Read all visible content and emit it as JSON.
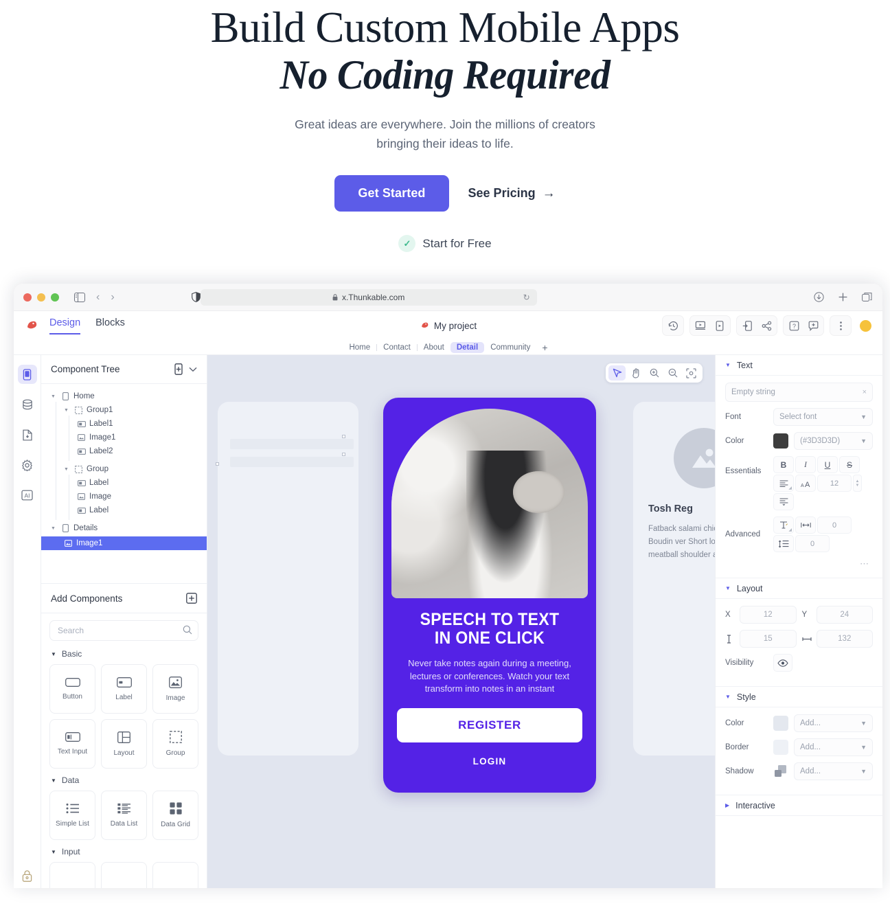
{
  "hero": {
    "headline_line1": "Build Custom Mobile Apps",
    "headline_line2": "No Coding Required",
    "subtext": "Great ideas are everywhere. Join the millions of creators bringing their ideas to life.",
    "primary_cta": "Get Started",
    "secondary_cta": "See Pricing",
    "secondary_cta_icon": "arrow-right-icon",
    "free_label": "Start for Free",
    "free_icon": "check-icon",
    "accent_color": "#5c5ce8",
    "check_color": "#3fba8e"
  },
  "browser": {
    "url": "x.Thunkable.com",
    "lock_icon": "lock-icon",
    "reload_icon": "reload-icon",
    "sidebar_icon": "sidebar-toggle-icon",
    "back_icon": "chevron-left-icon",
    "forward_icon": "chevron-right-icon",
    "shield_icon": "privacy-shield-icon",
    "download_icon": "download-icon",
    "newtab_icon": "plus-icon",
    "tabs_icon": "tab-overview-icon",
    "traffic_lights": [
      "close",
      "minimize",
      "zoom"
    ]
  },
  "app": {
    "logo_icon": "thunkable-logo-icon",
    "tabs": [
      {
        "label": "Design",
        "active": true
      },
      {
        "label": "Blocks",
        "active": false
      }
    ],
    "project_name": "My project",
    "toolbar_groups": [
      {
        "icons": [
          {
            "name": "version-history-icon"
          }
        ]
      },
      {
        "icons": [
          {
            "name": "preview-web-icon"
          },
          {
            "name": "preview-mobile-icon"
          }
        ]
      },
      {
        "icons": [
          {
            "name": "install-app-icon"
          },
          {
            "name": "share-icon"
          }
        ]
      },
      {
        "icons": [
          {
            "name": "help-icon"
          },
          {
            "name": "feedback-icon"
          }
        ]
      },
      {
        "icons": [
          {
            "name": "more-menu-icon"
          }
        ]
      }
    ],
    "avatar": "user-avatar"
  },
  "screens": {
    "items": [
      {
        "label": "Home",
        "active": false
      },
      {
        "label": "Contact",
        "active": false
      },
      {
        "label": "About",
        "active": false
      },
      {
        "label": "Detail",
        "active": true
      },
      {
        "label": "Community",
        "active": false
      }
    ],
    "add_label": "+"
  },
  "rail": {
    "items": [
      {
        "name": "screens-icon",
        "active": true
      },
      {
        "name": "data-sources-icon",
        "active": false
      },
      {
        "name": "assets-icon",
        "active": false
      },
      {
        "name": "settings-gear-icon",
        "active": false
      },
      {
        "name": "ai-icon",
        "active": false
      }
    ],
    "lock_icon": "lock-icon"
  },
  "component_tree": {
    "title": "Component Tree",
    "add_screen_icon": "add-screen-icon",
    "collapse_icon": "chevron-down-icon",
    "nodes": [
      {
        "label": "Home",
        "icon": "screen-icon",
        "depth": 0,
        "caret": "down",
        "selected": false
      },
      {
        "label": "Group1",
        "icon": "group-icon",
        "depth": 1,
        "caret": "down",
        "selected": false
      },
      {
        "label": "Label1",
        "icon": "label-icon",
        "depth": 2,
        "caret": "",
        "selected": false
      },
      {
        "label": "Image1",
        "icon": "image-icon",
        "depth": 2,
        "caret": "",
        "selected": false
      },
      {
        "label": "Label2",
        "icon": "label-icon",
        "depth": 2,
        "caret": "",
        "selected": false
      },
      {
        "label": "Group",
        "icon": "group-icon",
        "depth": 1,
        "caret": "down",
        "selected": false
      },
      {
        "label": "Label",
        "icon": "label-icon",
        "depth": 2,
        "caret": "",
        "selected": false
      },
      {
        "label": "Image",
        "icon": "image-icon",
        "depth": 2,
        "caret": "",
        "selected": false
      },
      {
        "label": "Label",
        "icon": "label-icon",
        "depth": 2,
        "caret": "",
        "selected": false
      },
      {
        "label": "Details",
        "icon": "screen-icon",
        "depth": 0,
        "caret": "down",
        "selected": false
      },
      {
        "label": "Image1",
        "icon": "image-icon",
        "depth": 1,
        "caret": "",
        "selected": true
      }
    ]
  },
  "add_components": {
    "title": "Add Components",
    "add_icon": "add-component-icon",
    "search_placeholder": "Search",
    "search_value": "",
    "search_icon": "search-icon",
    "groups": [
      {
        "name": "Basic",
        "expanded": true,
        "items": [
          {
            "label": "Button",
            "icon": "button-icon"
          },
          {
            "label": "Label",
            "icon": "label-icon"
          },
          {
            "label": "Image",
            "icon": "image-icon"
          },
          {
            "label": "Text Input",
            "icon": "text-input-icon"
          },
          {
            "label": "Layout",
            "icon": "layout-icon"
          },
          {
            "label": "Group",
            "icon": "group-icon"
          }
        ]
      },
      {
        "name": "Data",
        "expanded": true,
        "items": [
          {
            "label": "Simple List",
            "icon": "simple-list-icon"
          },
          {
            "label": "Data List",
            "icon": "data-list-icon"
          },
          {
            "label": "Data Grid",
            "icon": "data-grid-icon"
          }
        ]
      },
      {
        "name": "Input",
        "expanded": true,
        "items": []
      }
    ]
  },
  "canvas": {
    "tools": [
      {
        "name": "select-tool-icon",
        "active": true
      },
      {
        "name": "pan-hand-icon",
        "active": false
      },
      {
        "name": "zoom-in-icon",
        "active": false
      },
      {
        "name": "zoom-out-icon",
        "active": false
      },
      {
        "name": "fit-to-screen-icon",
        "active": false
      }
    ],
    "phone_preview": {
      "heading_line1": "SPEECH TO TEXT",
      "heading_line2": "IN ONE CLICK",
      "body": "Never take notes again during a meeting, lectures or conferences. Watch your text transform into notes in an instant",
      "primary_button": "REGISTER",
      "secondary_link": "LOGIN",
      "background_color": "#5422e6",
      "image_alt": "woman-with-headphones-photo"
    },
    "side_card": {
      "title": "Tosh Reg",
      "body": "Fatback salami chick bresaola. Boudin ver Short loin buffalo po meatball shoulder a",
      "avatar_icon": "image-placeholder-icon"
    }
  },
  "properties": {
    "text": {
      "section_label": "Text",
      "expanded": true,
      "value_placeholder": "Empty string",
      "value": "",
      "clear_icon": "clear-icon",
      "font_label": "Font",
      "font_value": "Select font",
      "color_label": "Color",
      "color_value": "(#3D3D3D)",
      "color_hex": "#3D3D3D",
      "essentials_label": "Essentials",
      "essentials_buttons": [
        "B",
        "I",
        "U",
        "S"
      ],
      "align_icon": "text-align-icon",
      "font_size_icon": "font-size-icon",
      "font_size_value": "12",
      "line_align_icon": "vertical-align-icon",
      "advanced_label": "Advanced",
      "advanced_icon": "text-transform-icon",
      "letter_spacing_icon": "letter-spacing-icon",
      "letter_spacing_value": "0",
      "line_height_icon": "line-height-icon",
      "line_height_value": "0",
      "more_icon": "more-options-icon"
    },
    "layout": {
      "section_label": "Layout",
      "expanded": true,
      "x_label": "X",
      "x_value": "12",
      "y_label": "Y",
      "y_value": "24",
      "height_icon": "height-icon",
      "height_value": "15",
      "width_icon": "width-icon",
      "width_value": "132",
      "visibility_label": "Visibility",
      "visibility_icon": "eye-icon"
    },
    "style": {
      "section_label": "Style",
      "expanded": true,
      "rows": [
        {
          "label": "Color",
          "value": "Add...",
          "swatch": "#e4e8ef",
          "swatch_kind": "flat"
        },
        {
          "label": "Border",
          "value": "Add...",
          "swatch": "#eef1f6",
          "swatch_kind": "flat"
        },
        {
          "label": "Shadow",
          "value": "Add...",
          "swatch": "#9aa1ae",
          "swatch_kind": "shadow"
        }
      ]
    },
    "interactive": {
      "section_label": "Interactive",
      "expanded": false
    }
  }
}
